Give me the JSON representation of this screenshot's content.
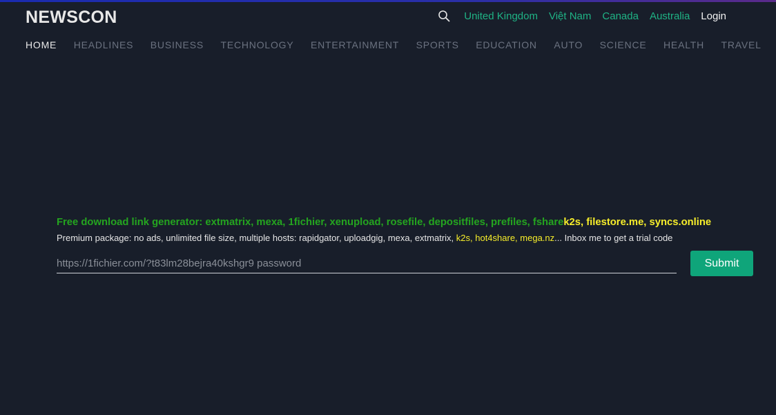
{
  "header": {
    "logo": "NEWSCON",
    "countries": [
      "United Kingdom",
      "Việt Nam",
      "Canada",
      "Australia"
    ],
    "login_label": "Login"
  },
  "nav": {
    "items": [
      "HOME",
      "HEADLINES",
      "BUSINESS",
      "TECHNOLOGY",
      "ENTERTAINMENT",
      "SPORTS",
      "EDUCATION",
      "AUTO",
      "SCIENCE",
      "HEALTH",
      "TRAVEL"
    ],
    "active": "HOME"
  },
  "promo": {
    "title_green": "Free download link generator: extmatrix, mexa, 1fichier, xenupload, rosefile, depositfiles, prefiles, fshare",
    "title_yellow": "k2s, filestore.me, syncs.online",
    "sub_text": "Premium package: no ads, unlimited file size, multiple hosts: rapidgator, uploadgig, mexa, extmatrix, ",
    "sub_highlight": "k2s, hot4share, mega.nz",
    "sub_tail": "... Inbox me to get a trial code"
  },
  "form": {
    "input_placeholder": "https://1fichier.com/?t83lm28bejra40kshgr9 password",
    "input_value": "",
    "submit_label": "Submit"
  },
  "colors": {
    "background": "#181e2a",
    "accent_green": "#1fb385",
    "promo_green": "#24a51f",
    "highlight_yellow": "#f7ee2a",
    "button": "#0fa57a",
    "nav_inactive": "#6b7280"
  },
  "icons": {
    "search": "search-icon"
  }
}
